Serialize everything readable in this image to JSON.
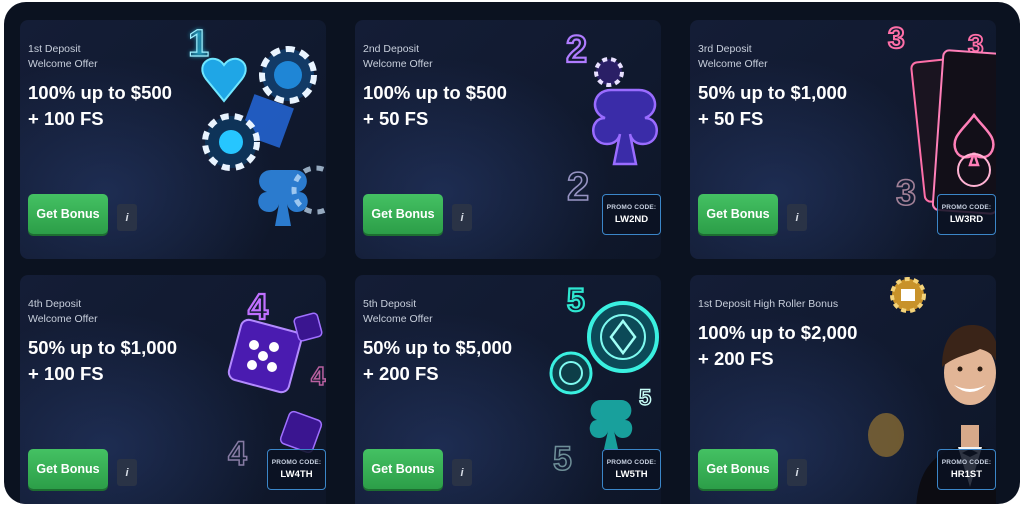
{
  "offers": [
    {
      "subtitle": "1st Deposit\nWelcome Offer",
      "headline": "100% up to $500\n+ 100 FS",
      "button": "Get Bonus",
      "info": "i",
      "promo_label": "",
      "promo_code": "",
      "theme": "cyan",
      "art_icons": [
        "digit-1-icon",
        "heart-icon",
        "poker-chip-icon",
        "club-icon"
      ]
    },
    {
      "subtitle": "2nd Deposit\nWelcome Offer",
      "headline": "100% up to $500\n+ 50 FS",
      "button": "Get Bonus",
      "info": "i",
      "promo_label": "PROMO CODE:",
      "promo_code": "LW2ND",
      "theme": "purple",
      "art_icons": [
        "digit-2-icon",
        "poker-chip-icon",
        "club-icon"
      ]
    },
    {
      "subtitle": "3rd Deposit\nWelcome Offer",
      "headline": "50% up to $1,000\n+ 50 FS",
      "button": "Get Bonus",
      "info": "i",
      "promo_label": "PROMO CODE:",
      "promo_code": "LW3RD",
      "theme": "pink",
      "art_icons": [
        "digit-3-icon",
        "playing-card-icon",
        "spade-icon"
      ]
    },
    {
      "subtitle": "4th Deposit\nWelcome Offer",
      "headline": "50% up to $1,000\n+ 100 FS",
      "button": "Get Bonus",
      "info": "i",
      "promo_label": "PROMO CODE:",
      "promo_code": "LW4TH",
      "theme": "violet",
      "art_icons": [
        "digit-4-icon",
        "dice-icon"
      ]
    },
    {
      "subtitle": "5th Deposit\nWelcome Offer",
      "headline": "50% up to $5,000\n+ 200 FS",
      "button": "Get Bonus",
      "info": "i",
      "promo_label": "PROMO CODE:",
      "promo_code": "LW5TH",
      "theme": "teal",
      "art_icons": [
        "digit-5-icon",
        "poker-chip-icon",
        "club-icon"
      ]
    },
    {
      "subtitle": "1st Deposit High Roller Bonus",
      "headline": "100% up to $2,000\n+ 200 FS",
      "button": "Get Bonus",
      "info": "i",
      "promo_label": "PROMO CODE:",
      "promo_code": "HR1ST",
      "theme": "gold",
      "art_icons": [
        "gold-chip-icon",
        "man-in-tuxedo-icon"
      ]
    }
  ],
  "colors": {
    "background": "#0b1220",
    "button": "#3aad57",
    "promo_border": "#3b86c8",
    "cyan": "#2fd9ff",
    "purple": "#a05cff",
    "pink": "#ff6fa8",
    "teal": "#2ee6d0",
    "gold": "#e0b140"
  }
}
